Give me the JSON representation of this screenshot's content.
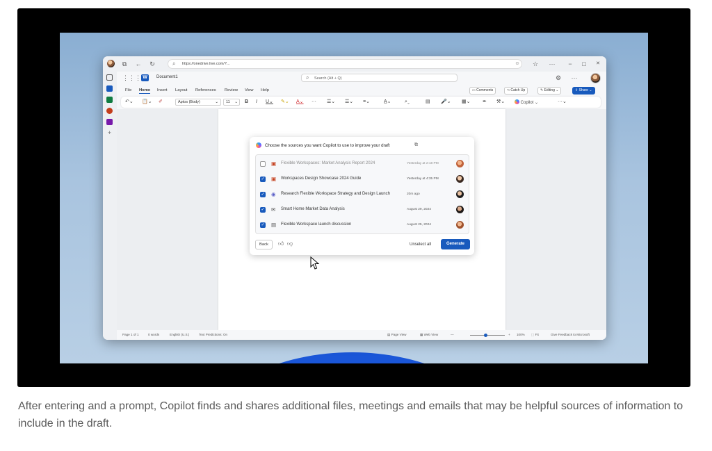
{
  "browser": {
    "url": "https://onedrive.live.com/?...",
    "window_controls": [
      "−",
      "□",
      "✕"
    ]
  },
  "word": {
    "app": "Word",
    "doc_name": "Document1",
    "search_placeholder": "Search (Alt + Q)",
    "menu": [
      "File",
      "Home",
      "Insert",
      "Layout",
      "References",
      "Review",
      "View",
      "Help"
    ],
    "active_menu": "Home",
    "actions": {
      "comments": "Comments",
      "catch_up": "Catch Up",
      "editing": "Editing",
      "share": "Share"
    },
    "ribbon": {
      "font": "Aptos (Body)",
      "size": "11",
      "copilot": "Copilot"
    },
    "status": {
      "page": "Page 1 of 1",
      "words": "0 words",
      "language": "English (U.S.)",
      "predictions": "Text Predictions: On",
      "page_view": "Page View",
      "web_view": "Web View",
      "zoom": "100%",
      "fit": "Fit",
      "feedback": "Give Feedback to Microsoft"
    }
  },
  "dialog": {
    "title": "Choose the sources you want Copilot to use to improve your draft",
    "items": [
      {
        "title": "Flexible Workspaces: Market Analysis Report 2024",
        "date": "Yesterday at 2:18 PM",
        "checked": false,
        "icon": "ppt-file-icon",
        "color": "#c43e1c"
      },
      {
        "title": "Workspaces Design Showcase 2024 Guide",
        "date": "Yesterday at 4:35 PM",
        "checked": true,
        "icon": "ppt-file-icon",
        "color": "#c43e1c"
      },
      {
        "title": "Research Flexible Workspace Strategy and Design Launch",
        "date": "20m ago",
        "checked": true,
        "icon": "meeting-icon",
        "color": "#5b5fc7"
      },
      {
        "title": "Smart Home Market Data Analysis",
        "date": "August 29, 2024",
        "checked": true,
        "icon": "mail-icon",
        "color": "#555555"
      },
      {
        "title": "Flexible Workspace launch discussion",
        "date": "August 25, 2024",
        "checked": true,
        "icon": "chat-icon",
        "color": "#555555"
      }
    ],
    "back": "Back",
    "unselect_all": "Unselect all",
    "generate": "Generate"
  },
  "caption": "After entering and a prompt, Copilot finds and shares additional files, meetings and emails that may be helpful sources of information to include in the draft.",
  "colors": {
    "accent": "#185abd",
    "frame": "#000000",
    "wallpaper": "#a9c4df"
  }
}
